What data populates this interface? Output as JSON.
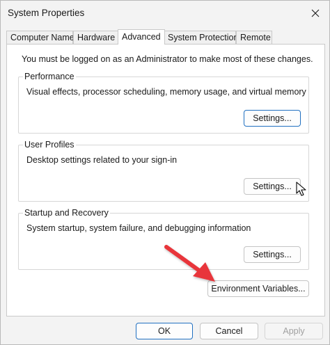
{
  "window": {
    "title": "System Properties"
  },
  "tabs": [
    {
      "label": "Computer Name",
      "active": false
    },
    {
      "label": "Hardware",
      "active": false
    },
    {
      "label": "Advanced",
      "active": true
    },
    {
      "label": "System Protection",
      "active": false
    },
    {
      "label": "Remote",
      "active": false
    }
  ],
  "intro_text": "You must be logged on as an Administrator to make most of these changes.",
  "groups": {
    "performance": {
      "title": "Performance",
      "description": "Visual effects, processor scheduling, memory usage, and virtual memory",
      "button_label": "Settings..."
    },
    "user_profiles": {
      "title": "User Profiles",
      "description": "Desktop settings related to your sign-in",
      "button_label": "Settings..."
    },
    "startup_recovery": {
      "title": "Startup and Recovery",
      "description": "System startup, system failure, and debugging information",
      "button_label": "Settings..."
    }
  },
  "environment_button_label": "Environment Variables...",
  "footer": {
    "ok_label": "OK",
    "cancel_label": "Cancel",
    "apply_label": "Apply"
  },
  "colors": {
    "accent": "#1f6fc0",
    "annotation_arrow": "#e8343a"
  },
  "icons": {
    "close": "close-icon",
    "cursor": "mouse-pointer-icon",
    "annotation": "annotation-arrow-icon"
  }
}
